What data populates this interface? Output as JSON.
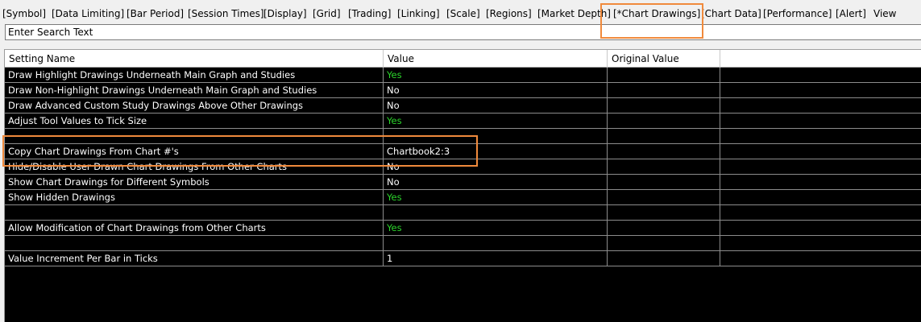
{
  "menu": [
    "[Symbol]",
    "[Data Limiting]",
    "[Bar Period]",
    "[Session Times]",
    "[Display]",
    "[Grid]",
    "[Trading]",
    "[Linking]",
    "[Scale]",
    "[Regions]",
    "[Market Depth]",
    "[*Chart Drawings]",
    "[Chart Data]",
    "[Performance]",
    "[Alert]",
    "View"
  ],
  "search": {
    "placeholder": "Enter Search Text"
  },
  "columns": {
    "name": "Setting Name",
    "value": "Value",
    "original": "Original Value"
  },
  "rows": [
    {
      "name": "Draw Highlight Drawings Underneath Main Graph and Studies",
      "value": "Yes",
      "original": ""
    },
    {
      "name": "Draw Non-Highlight Drawings Underneath Main Graph and Studies",
      "value": "No",
      "original": ""
    },
    {
      "name": "Draw Advanced Custom Study Drawings Above Other Drawings",
      "value": "No",
      "original": ""
    },
    {
      "name": "Adjust Tool Values to Tick Size",
      "value": "Yes",
      "original": ""
    },
    {
      "name": "",
      "value": "",
      "original": ""
    },
    {
      "name": "Copy Chart Drawings From Chart #'s",
      "value": "Chartbook2:3",
      "original": ""
    },
    {
      "name": "Hide/Disable User Drawn Chart Drawings From Other Charts",
      "value": "No",
      "original": ""
    },
    {
      "name": "Show Chart Drawings for Different Symbols",
      "value": "No",
      "original": ""
    },
    {
      "name": "Show Hidden Drawings",
      "value": "Yes",
      "original": ""
    },
    {
      "name": "",
      "value": "",
      "original": ""
    },
    {
      "name": "Allow Modification of Chart Drawings from Other Charts",
      "value": "Yes",
      "original": ""
    },
    {
      "name": "",
      "value": "",
      "original": ""
    },
    {
      "name": "Value Increment Per Bar in Ticks",
      "value": "1",
      "original": ""
    }
  ],
  "colors": {
    "yes": "#2bd42b",
    "highlight": "#f08a3c",
    "grid_bg": "#000000"
  }
}
